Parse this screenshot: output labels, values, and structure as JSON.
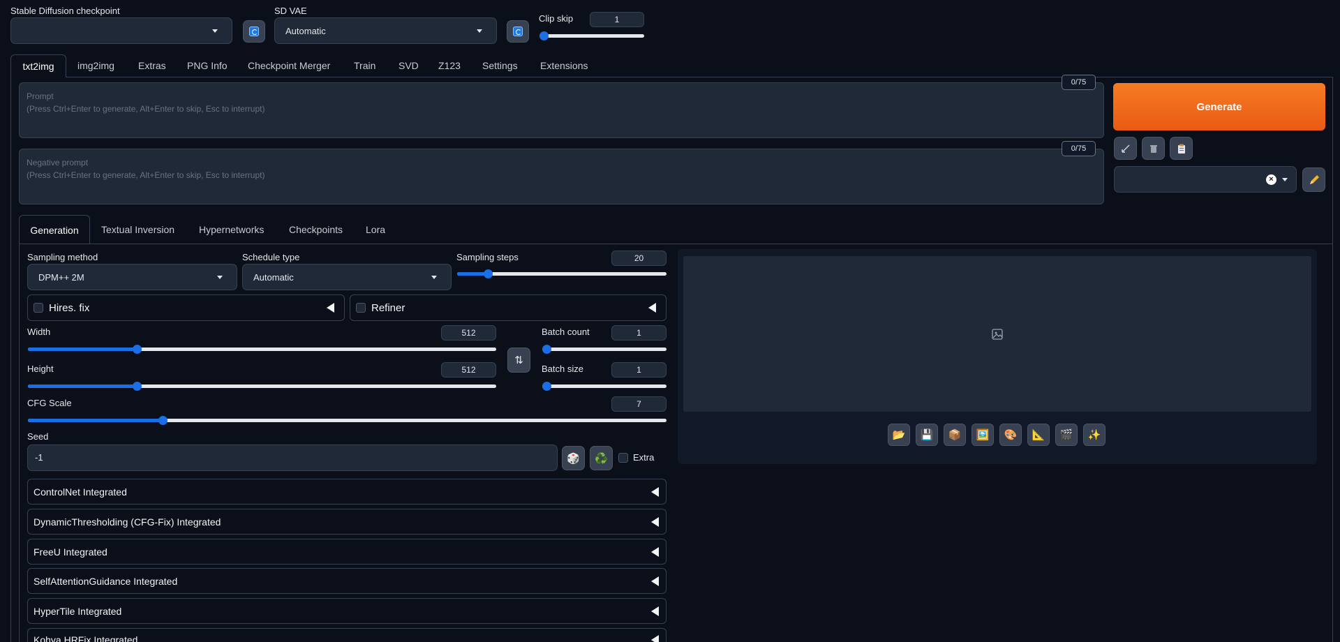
{
  "top": {
    "checkpoint_label": "Stable Diffusion checkpoint",
    "checkpoint_value": "",
    "vae_label": "SD VAE",
    "vae_value": "Automatic",
    "clip_skip_label": "Clip skip",
    "clip_skip_value": "1"
  },
  "main_tabs": [
    {
      "label": "txt2img"
    },
    {
      "label": "img2img"
    },
    {
      "label": "Extras"
    },
    {
      "label": "PNG Info"
    },
    {
      "label": "Checkpoint Merger"
    },
    {
      "label": "Train"
    },
    {
      "label": "SVD"
    },
    {
      "label": "Z123"
    },
    {
      "label": "Settings"
    },
    {
      "label": "Extensions"
    }
  ],
  "prompt": {
    "label": "Prompt",
    "hint": "(Press Ctrl+Enter to generate, Alt+Enter to skip, Esc to interrupt)",
    "token_counter": "0/75"
  },
  "negative_prompt": {
    "label": "Negative prompt",
    "hint": "(Press Ctrl+Enter to generate, Alt+Enter to skip, Esc to interrupt)",
    "token_counter": "0/75"
  },
  "generate_label": "Generate",
  "sub_tabs": [
    {
      "label": "Generation"
    },
    {
      "label": "Textual Inversion"
    },
    {
      "label": "Hypernetworks"
    },
    {
      "label": "Checkpoints"
    },
    {
      "label": "Lora"
    }
  ],
  "params": {
    "sampling_method_label": "Sampling method",
    "sampling_method_value": "DPM++ 2M",
    "schedule_type_label": "Schedule type",
    "schedule_type_value": "Automatic",
    "sampling_steps_label": "Sampling steps",
    "sampling_steps_value": "20",
    "hires_label": "Hires. fix",
    "refiner_label": "Refiner",
    "width_label": "Width",
    "width_value": "512",
    "height_label": "Height",
    "height_value": "512",
    "batch_count_label": "Batch count",
    "batch_count_value": "1",
    "batch_size_label": "Batch size",
    "batch_size_value": "1",
    "cfg_label": "CFG Scale",
    "cfg_value": "7",
    "seed_label": "Seed",
    "seed_value": "-1",
    "extra_label": "Extra"
  },
  "accordions": [
    {
      "label": "ControlNet Integrated"
    },
    {
      "label": "DynamicThresholding (CFG-Fix) Integrated"
    },
    {
      "label": "FreeU Integrated"
    },
    {
      "label": "SelfAttentionGuidance Integrated"
    },
    {
      "label": "HyperTile Integrated"
    },
    {
      "label": "Kohya HRFix Integrated"
    }
  ],
  "output_tools": [
    {
      "icon": "folder-icon",
      "glyph": "📂"
    },
    {
      "icon": "save-icon",
      "glyph": "💾"
    },
    {
      "icon": "zip-icon",
      "glyph": "📦"
    },
    {
      "icon": "send-to-img2img-icon",
      "glyph": "🖼️"
    },
    {
      "icon": "send-to-inpaint-icon",
      "glyph": "🎨"
    },
    {
      "icon": "send-to-extras-icon",
      "glyph": "📐"
    },
    {
      "icon": "svd-icon",
      "glyph": "🎬"
    },
    {
      "icon": "sparkle-icon",
      "glyph": "✨"
    }
  ],
  "colors": {
    "background": "#0b0f19",
    "generate": "#f26a1b",
    "accent": "#1a6fe6"
  }
}
